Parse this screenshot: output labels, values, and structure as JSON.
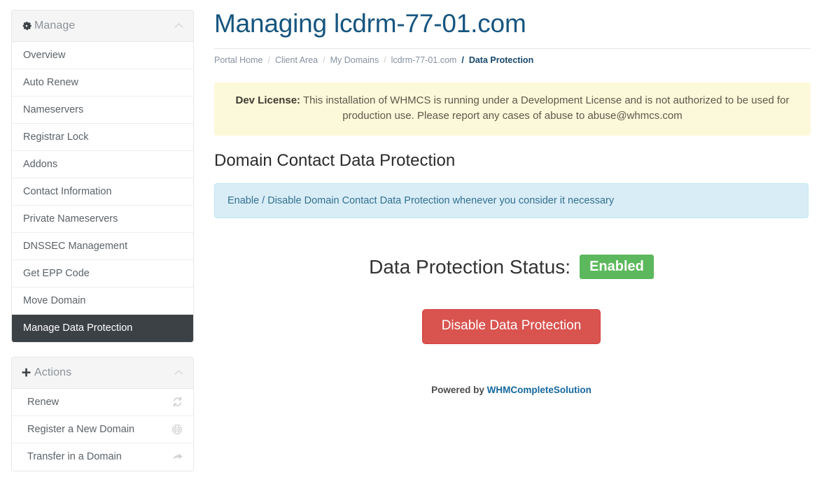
{
  "header": {
    "title": "Managing lcdrm-77-01.com"
  },
  "breadcrumb": {
    "separator": "/",
    "items": [
      {
        "label": "Portal Home",
        "active": false
      },
      {
        "label": "Client Area",
        "active": false
      },
      {
        "label": "My Domains",
        "active": false
      },
      {
        "label": "lcdrm-77-01.com",
        "active": false
      },
      {
        "label": "Data Protection",
        "active": true
      }
    ]
  },
  "alerts": {
    "dev_license": {
      "prefix": "Dev License:",
      "text": " This installation of WHMCS is running under a Development License and is not authorized to be used for production use. Please report any cases of abuse to abuse@whmcs.com",
      "background": "#fcf8da"
    },
    "info": {
      "text": "Enable / Disable Domain Contact Data Protection whenever you consider it necessary",
      "background": "#d9edf7",
      "border": "#bce8f1",
      "text_color": "#31708f"
    }
  },
  "main": {
    "section_title": "Domain Contact Data Protection",
    "status_label": "Data Protection Status:",
    "status_value": "Enabled",
    "status_color": "#5cb85c",
    "action_button": "Disable Data Protection",
    "action_button_color": "#d9534f"
  },
  "footer": {
    "powered_by": "Powered by ",
    "link_label": "WHMCompleteSolution",
    "link_color": "#15679e"
  },
  "sidebar": {
    "manage_panel": {
      "title": "Manage",
      "icon": "gear-icon",
      "collapse_icon": "chevron-up-icon",
      "items": [
        {
          "label": "Overview",
          "active": false
        },
        {
          "label": "Auto Renew",
          "active": false
        },
        {
          "label": "Nameservers",
          "active": false
        },
        {
          "label": "Registrar Lock",
          "active": false
        },
        {
          "label": "Addons",
          "active": false
        },
        {
          "label": "Contact Information",
          "active": false
        },
        {
          "label": "Private Nameservers",
          "active": false
        },
        {
          "label": "DNSSEC Management",
          "active": false
        },
        {
          "label": "Get EPP Code",
          "active": false
        },
        {
          "label": "Move Domain",
          "active": false
        },
        {
          "label": "Manage Data Protection",
          "active": true
        }
      ]
    },
    "actions_panel": {
      "title": "Actions",
      "icon": "plus-icon",
      "collapse_icon": "chevron-up-icon",
      "items": [
        {
          "label": "Renew",
          "icon": "refresh-icon"
        },
        {
          "label": "Register a New Domain",
          "icon": "globe-icon"
        },
        {
          "label": "Transfer in a Domain",
          "icon": "share-arrow-icon"
        }
      ]
    }
  }
}
